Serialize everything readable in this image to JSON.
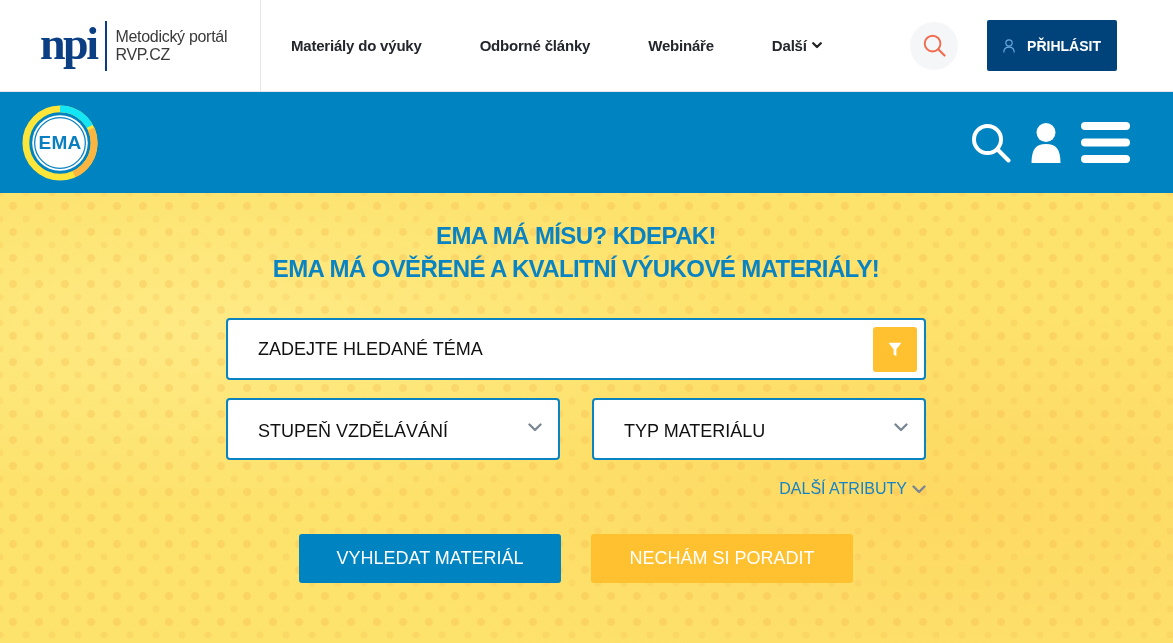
{
  "header": {
    "logo": {
      "mark": "npi",
      "line1": "Metodický portál",
      "line2": "RVP.CZ"
    },
    "nav": [
      {
        "label": "Materiály do výuky",
        "has_dropdown": false
      },
      {
        "label": "Odborné články",
        "has_dropdown": false
      },
      {
        "label": "Webináře",
        "has_dropdown": false
      },
      {
        "label": "Další",
        "has_dropdown": true
      }
    ],
    "login_button": "PŘIHLÁSIT"
  },
  "ema_bar": {
    "logo": "EMA"
  },
  "hero": {
    "heading": [
      "EMA MÁ MÍSU? KDEPAK!",
      "EMA MÁ OVĚŘENÉ A KVALITNÍ VÝUKOVÉ MATERIÁLY!"
    ],
    "search": {
      "placeholder": "ZADEJTE HLEDANÉ TÉMA"
    },
    "selects": [
      {
        "text": "STUPEŇ VZDĚLÁVÁNÍ"
      },
      {
        "text": "TYP MATERIÁLU"
      }
    ],
    "more_link": "DALŠÍ ATRIBUTY",
    "buttons": [
      {
        "label": "VYHLEDAT MATERIÁL",
        "kind": "primary"
      },
      {
        "label": "NECHÁM SI PORADIT",
        "kind": "secondary"
      }
    ]
  }
}
